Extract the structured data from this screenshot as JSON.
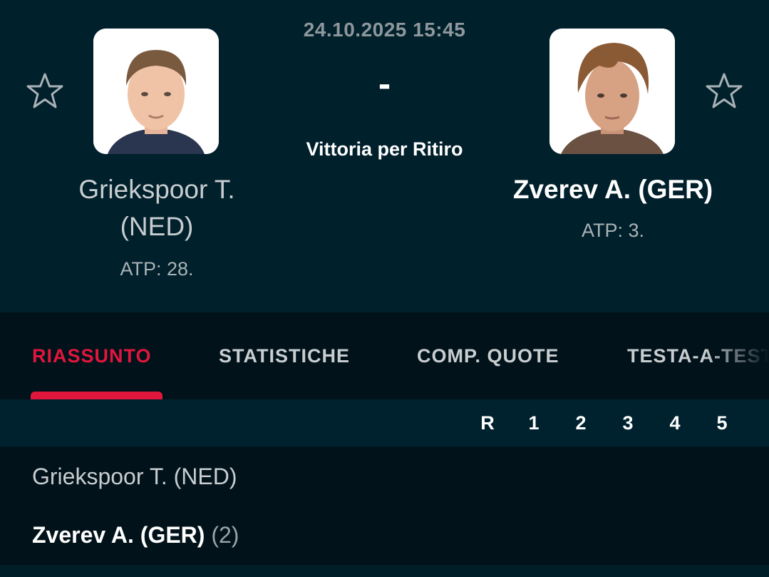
{
  "match": {
    "datetime": "24.10.2025 15:45",
    "score": "-",
    "status": "Vittoria per Ritiro"
  },
  "player1": {
    "name_line1": "Griekspoor T.",
    "name_line2": "(NED)",
    "rank": "ATP: 28.",
    "favorite_icon": "star-outline-icon"
  },
  "player2": {
    "name": "Zverev A. (GER)",
    "rank": "ATP: 3.",
    "favorite_icon": "star-outline-icon"
  },
  "tabs": [
    {
      "label": "RIASSUNTO",
      "active": true
    },
    {
      "label": "STATISTICHE",
      "active": false
    },
    {
      "label": "COMP. QUOTE",
      "active": false
    },
    {
      "label": "TESTA-A-TESTA",
      "active": false
    }
  ],
  "score_table": {
    "columns": [
      "R",
      "1",
      "2",
      "3",
      "4",
      "5"
    ],
    "rows": [
      {
        "name": "Griekspoor T. (NED)",
        "seed": ""
      },
      {
        "name": "Zverev A. (GER)",
        "seed": "(2)"
      }
    ]
  },
  "colors": {
    "accent": "#e1163c",
    "background": "#00202b"
  }
}
